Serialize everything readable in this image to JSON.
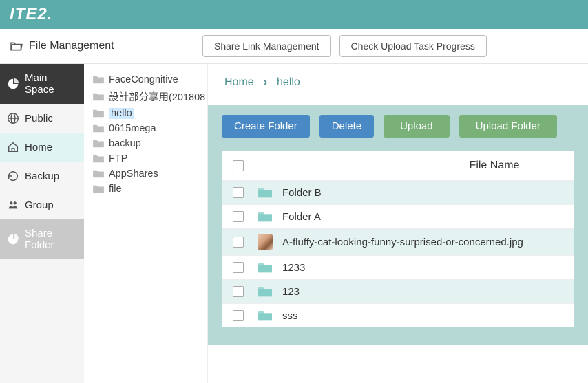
{
  "brand": "ITE2.",
  "header": {
    "title": "File Management",
    "share_link_btn": "Share Link Management",
    "check_upload_btn": "Check Upload Task Progress"
  },
  "sidebar": {
    "items": [
      {
        "label": "Main Space"
      },
      {
        "label": "Public"
      },
      {
        "label": "Home"
      },
      {
        "label": "Backup"
      },
      {
        "label": "Group"
      },
      {
        "label": "Share Folder"
      }
    ]
  },
  "tree": {
    "items": [
      {
        "label": "FaceCongnitive"
      },
      {
        "label": "設計部分享用(201808"
      },
      {
        "label": "hello"
      },
      {
        "label": "0615mega"
      },
      {
        "label": "backup"
      },
      {
        "label": "FTP"
      },
      {
        "label": "AppShares"
      },
      {
        "label": "file"
      }
    ]
  },
  "breadcrumb": {
    "home": "Home",
    "current": "hello"
  },
  "actions": {
    "create_folder": "Create Folder",
    "delete": "Delete",
    "upload": "Upload",
    "upload_folder": "Upload Folder"
  },
  "table": {
    "col_name": "File Name",
    "rows": [
      {
        "type": "folder",
        "name": "Folder B"
      },
      {
        "type": "folder",
        "name": "Folder A"
      },
      {
        "type": "image",
        "name": "A-fluffy-cat-looking-funny-surprised-or-concerned.jpg"
      },
      {
        "type": "folder",
        "name": "1233"
      },
      {
        "type": "folder",
        "name": "123"
      },
      {
        "type": "folder",
        "name": "sss"
      }
    ]
  }
}
